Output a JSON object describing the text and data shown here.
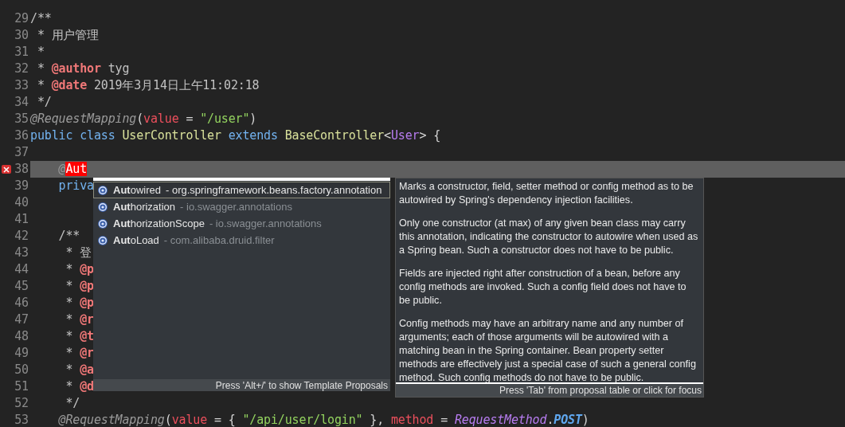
{
  "editor": {
    "lines": [
      {
        "number": "29",
        "current": false,
        "error": false,
        "segments": [
          {
            "kind": "comment",
            "text": "/**"
          }
        ]
      },
      {
        "number": "30",
        "current": false,
        "error": false,
        "segments": [
          {
            "kind": "comment",
            "text": " * 用户管理"
          }
        ]
      },
      {
        "number": "31",
        "current": false,
        "error": false,
        "segments": [
          {
            "kind": "comment",
            "text": " *"
          }
        ]
      },
      {
        "number": "32",
        "current": false,
        "error": false,
        "segments": [
          {
            "kind": "comment",
            "text": " * "
          },
          {
            "kind": "tag",
            "text": "@author"
          },
          {
            "kind": "comment",
            "text": " tyg"
          }
        ]
      },
      {
        "number": "33",
        "current": false,
        "error": false,
        "segments": [
          {
            "kind": "comment",
            "text": " * "
          },
          {
            "kind": "tag",
            "text": "@date"
          },
          {
            "kind": "comment",
            "text": " 2019年3月14日上午11:02:18"
          }
        ]
      },
      {
        "number": "34",
        "current": false,
        "error": false,
        "segments": [
          {
            "kind": "comment",
            "text": " */"
          }
        ]
      },
      {
        "number": "35",
        "current": false,
        "error": false,
        "segments": [
          {
            "kind": "annotation",
            "text": "@RequestMapping"
          },
          {
            "kind": "plain",
            "text": "("
          },
          {
            "kind": "attr",
            "text": "value"
          },
          {
            "kind": "plain",
            "text": " = "
          },
          {
            "kind": "string",
            "text": "\"/user\""
          },
          {
            "kind": "plain",
            "text": ")"
          }
        ]
      },
      {
        "number": "36",
        "current": false,
        "error": false,
        "segments": [
          {
            "kind": "keyword",
            "text": "public class "
          },
          {
            "kind": "type",
            "text": "UserController "
          },
          {
            "kind": "keyword",
            "text": "extends "
          },
          {
            "kind": "type",
            "text": "BaseController"
          },
          {
            "kind": "plain",
            "text": "<"
          },
          {
            "kind": "typeparam",
            "text": "User"
          },
          {
            "kind": "plain",
            "text": "> {"
          }
        ]
      },
      {
        "number": "37",
        "current": false,
        "error": false
      },
      {
        "number": "38",
        "current": true,
        "error": true,
        "segments": [
          {
            "kind": "annotation",
            "text": "    @"
          },
          {
            "kind": "error",
            "text": "Aut"
          }
        ]
      },
      {
        "number": "39",
        "current": false,
        "error": false,
        "segments": [
          {
            "kind": "keyword",
            "text": "    priva"
          }
        ]
      },
      {
        "number": "40",
        "current": false,
        "error": false
      },
      {
        "number": "41",
        "current": false,
        "error": false
      },
      {
        "number": "42",
        "current": false,
        "error": false,
        "segments": [
          {
            "kind": "comment",
            "text": "    /**"
          }
        ]
      },
      {
        "number": "43",
        "current": false,
        "error": false,
        "segments": [
          {
            "kind": "comment",
            "text": "     * 登"
          }
        ]
      },
      {
        "number": "44",
        "current": false,
        "error": false,
        "segments": [
          {
            "kind": "comment",
            "text": "     * "
          },
          {
            "kind": "tag",
            "text": "@p"
          }
        ]
      },
      {
        "number": "45",
        "current": false,
        "error": false,
        "segments": [
          {
            "kind": "comment",
            "text": "     * "
          },
          {
            "kind": "tag",
            "text": "@p"
          }
        ]
      },
      {
        "number": "46",
        "current": false,
        "error": false,
        "segments": [
          {
            "kind": "comment",
            "text": "     * "
          },
          {
            "kind": "tag",
            "text": "@p"
          }
        ]
      },
      {
        "number": "47",
        "current": false,
        "error": false,
        "segments": [
          {
            "kind": "comment",
            "text": "     * "
          },
          {
            "kind": "tag",
            "text": "@r"
          }
        ]
      },
      {
        "number": "48",
        "current": false,
        "error": false,
        "segments": [
          {
            "kind": "comment",
            "text": "     * "
          },
          {
            "kind": "tag",
            "text": "@t"
          }
        ]
      },
      {
        "number": "49",
        "current": false,
        "error": false,
        "segments": [
          {
            "kind": "comment",
            "text": "     * "
          },
          {
            "kind": "tag",
            "text": "@r"
          }
        ]
      },
      {
        "number": "50",
        "current": false,
        "error": false,
        "segments": [
          {
            "kind": "comment",
            "text": "     * "
          },
          {
            "kind": "tag",
            "text": "@a"
          }
        ]
      },
      {
        "number": "51",
        "current": false,
        "error": false,
        "segments": [
          {
            "kind": "comment",
            "text": "     * "
          },
          {
            "kind": "tag",
            "text": "@d"
          }
        ]
      },
      {
        "number": "52",
        "current": false,
        "error": false,
        "segments": [
          {
            "kind": "comment",
            "text": "     */"
          }
        ]
      },
      {
        "number": "53",
        "current": false,
        "error": false,
        "segments": [
          {
            "kind": "annotation",
            "text": "    @RequestMapping"
          },
          {
            "kind": "plain",
            "text": "("
          },
          {
            "kind": "attr",
            "text": "value"
          },
          {
            "kind": "plain",
            "text": " = { "
          },
          {
            "kind": "string",
            "text": "\"/api/user/login\""
          },
          {
            "kind": "plain",
            "text": " }, "
          },
          {
            "kind": "attr",
            "text": "method"
          },
          {
            "kind": "plain",
            "text": " = "
          },
          {
            "kind": "enum",
            "text": "RequestMethod"
          },
          {
            "kind": "plain",
            "text": "."
          },
          {
            "kind": "constant",
            "text": "POST"
          },
          {
            "kind": "plain",
            "text": ")"
          }
        ]
      }
    ]
  },
  "proposals": {
    "items": [
      {
        "name": "**Aut**owired",
        "qualifier": "- org.springframework.beans.factory.annotation",
        "selected": true
      },
      {
        "name": "**Aut**horization",
        "qualifier": "- io.swagger.annotations",
        "selected": false
      },
      {
        "name": "**Aut**horizationScope",
        "qualifier": "- io.swagger.annotations",
        "selected": false
      },
      {
        "name": "**Aut**oLoad",
        "qualifier": "- com.alibaba.druid.filter",
        "selected": false
      }
    ],
    "footer": "Press 'Alt+/' to show Template Proposals"
  },
  "documentation": {
    "paragraphs": [
      "Marks a constructor, field, setter method or config method as to be autowired by Spring's dependency injection facilities.",
      "Only one constructor (at max) of any given bean class may carry this annotation, indicating the constructor to autowire when used as a Spring bean. Such a constructor does not have to be public.",
      "Fields are injected right after construction of a bean, before any config methods are invoked. Such a config field does not have to be public.",
      "Config methods may have an arbitrary name and any number of arguments; each of those arguments will be autowired with a matching bean in the Spring container. Bean property setter methods are effectively just a special case of such a general config method. Such config methods do not have to be public."
    ],
    "footer": "Press 'Tab' from proposal table or click for focus"
  }
}
